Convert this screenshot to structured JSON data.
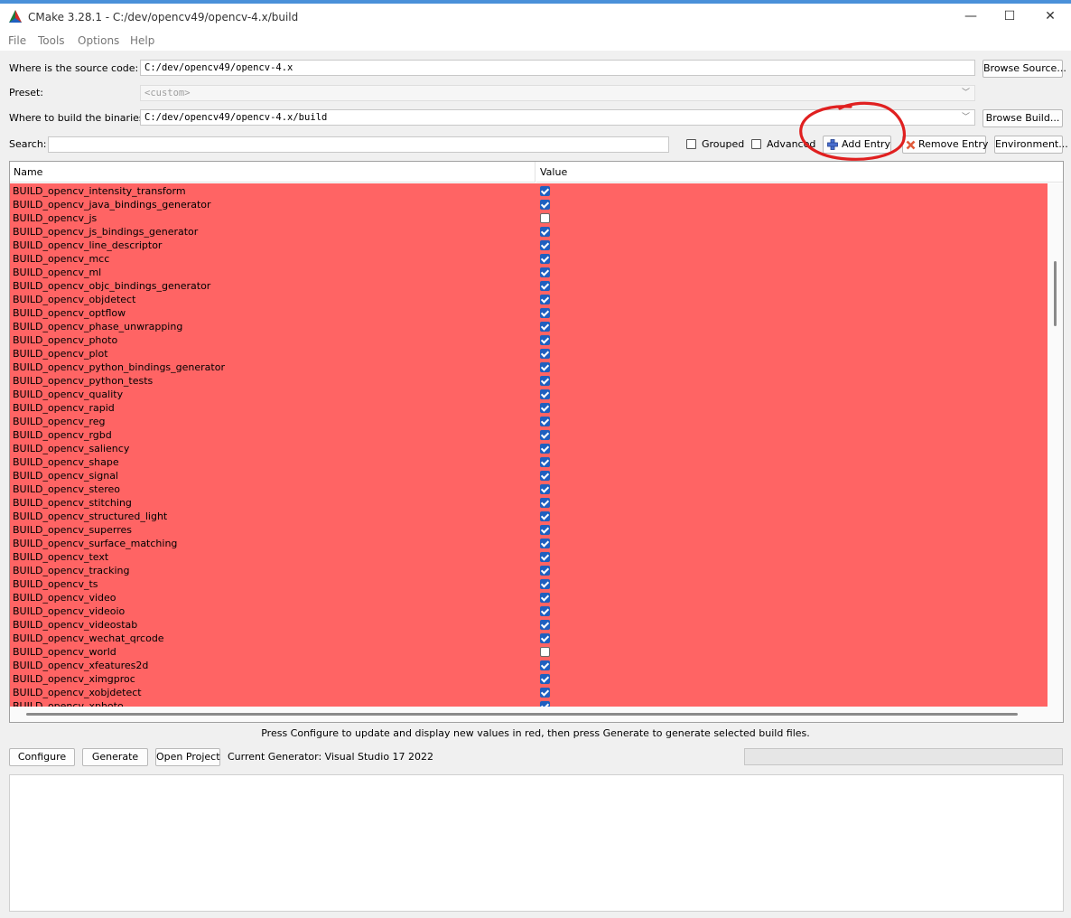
{
  "window": {
    "title": "CMake 3.28.1 - C:/dev/opencv49/opencv-4.x/build",
    "minimize": "—",
    "maximize": "☐",
    "close": "✕"
  },
  "menu": [
    "File",
    "Tools",
    "Options",
    "Help"
  ],
  "source": {
    "label": "Where is the source code:",
    "value": "C:/dev/opencv49/opencv-4.x",
    "browse": "Browse Source..."
  },
  "preset": {
    "label": "Preset:",
    "value": "<custom>"
  },
  "build": {
    "label": "Where to build the binaries:",
    "value": "C:/dev/opencv49/opencv-4.x/build",
    "browse": "Browse Build..."
  },
  "search": {
    "label": "Search:",
    "value": ""
  },
  "toolbar": {
    "grouped": "Grouped",
    "advanced": "Advanced",
    "add_entry": "Add Entry",
    "remove_entry": "Remove Entry",
    "environment": "Environment..."
  },
  "table": {
    "columns": [
      "Name",
      "Value"
    ],
    "rows": [
      {
        "name": "BUILD_opencv_intensity_transform",
        "checked": true
      },
      {
        "name": "BUILD_opencv_java_bindings_generator",
        "checked": true
      },
      {
        "name": "BUILD_opencv_js",
        "checked": false
      },
      {
        "name": "BUILD_opencv_js_bindings_generator",
        "checked": true
      },
      {
        "name": "BUILD_opencv_line_descriptor",
        "checked": true
      },
      {
        "name": "BUILD_opencv_mcc",
        "checked": true
      },
      {
        "name": "BUILD_opencv_ml",
        "checked": true
      },
      {
        "name": "BUILD_opencv_objc_bindings_generator",
        "checked": true
      },
      {
        "name": "BUILD_opencv_objdetect",
        "checked": true
      },
      {
        "name": "BUILD_opencv_optflow",
        "checked": true
      },
      {
        "name": "BUILD_opencv_phase_unwrapping",
        "checked": true
      },
      {
        "name": "BUILD_opencv_photo",
        "checked": true
      },
      {
        "name": "BUILD_opencv_plot",
        "checked": true
      },
      {
        "name": "BUILD_opencv_python_bindings_generator",
        "checked": true
      },
      {
        "name": "BUILD_opencv_python_tests",
        "checked": true
      },
      {
        "name": "BUILD_opencv_quality",
        "checked": true
      },
      {
        "name": "BUILD_opencv_rapid",
        "checked": true
      },
      {
        "name": "BUILD_opencv_reg",
        "checked": true
      },
      {
        "name": "BUILD_opencv_rgbd",
        "checked": true
      },
      {
        "name": "BUILD_opencv_saliency",
        "checked": true
      },
      {
        "name": "BUILD_opencv_shape",
        "checked": true
      },
      {
        "name": "BUILD_opencv_signal",
        "checked": true
      },
      {
        "name": "BUILD_opencv_stereo",
        "checked": true
      },
      {
        "name": "BUILD_opencv_stitching",
        "checked": true
      },
      {
        "name": "BUILD_opencv_structured_light",
        "checked": true
      },
      {
        "name": "BUILD_opencv_superres",
        "checked": true
      },
      {
        "name": "BUILD_opencv_surface_matching",
        "checked": true
      },
      {
        "name": "BUILD_opencv_text",
        "checked": true
      },
      {
        "name": "BUILD_opencv_tracking",
        "checked": true
      },
      {
        "name": "BUILD_opencv_ts",
        "checked": true
      },
      {
        "name": "BUILD_opencv_video",
        "checked": true
      },
      {
        "name": "BUILD_opencv_videoio",
        "checked": true
      },
      {
        "name": "BUILD_opencv_videostab",
        "checked": true
      },
      {
        "name": "BUILD_opencv_wechat_qrcode",
        "checked": true
      },
      {
        "name": "BUILD_opencv_world",
        "checked": false
      },
      {
        "name": "BUILD_opencv_xfeatures2d",
        "checked": true
      },
      {
        "name": "BUILD_opencv_ximgproc",
        "checked": true
      },
      {
        "name": "BUILD_opencv_xobjdetect",
        "checked": true
      },
      {
        "name": "BUILD_opencv_xphoto",
        "checked": true
      }
    ]
  },
  "hint": "Press Configure to update and display new values in red, then press Generate to generate selected build files.",
  "actions": {
    "configure": "Configure",
    "generate": "Generate",
    "open_project": "Open Project",
    "generator": "Current Generator: Visual Studio 17 2022"
  },
  "colors": {
    "new_entry_red": "#ff6464",
    "checkbox_blue": "#1f5fbf",
    "annotation_red": "#e02020"
  }
}
